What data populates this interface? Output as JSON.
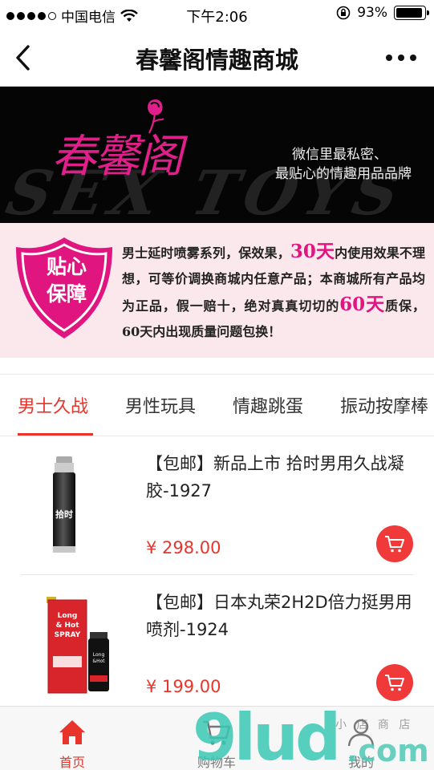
{
  "status_bar": {
    "carrier": "中国电信",
    "time": "下午2:06",
    "battery": "93%",
    "battery_level": 0.93,
    "signal_bars_filled": 4
  },
  "navbar": {
    "title": "春馨阁情趣商城"
  },
  "banner": {
    "logo_text": "春馨阁",
    "slogan_line1": "微信里最私密、",
    "slogan_line2": "最贴心的情趣用品品牌",
    "watermark": "SEX TOYS"
  },
  "guarantee": {
    "badge_line1": "贴心",
    "badge_line2": "保障",
    "text_part1": "男士延时喷雾系列，保效果，",
    "highlight1": "30天",
    "text_part2": "内使用效果不理想，可等价调换商城内任意产品；本商城所有产品均为正品，假一赔十，绝对真真切切的",
    "highlight2": "60天",
    "text_part3": "质保，60天内出现质量问题包换！"
  },
  "tabs": [
    {
      "label": "男士久战",
      "active": true
    },
    {
      "label": "男性玩具",
      "active": false
    },
    {
      "label": "情趣跳蛋",
      "active": false
    },
    {
      "label": "振动按摩棒",
      "active": false
    }
  ],
  "products": [
    {
      "title": "【包邮】新品上市 拾时男用久战凝胶-1927",
      "price": "¥ 298.00",
      "image_label": "拾时"
    },
    {
      "title": "【包邮】日本丸荣2H2D倍力挺男用喷剂-1924",
      "price": "¥ 199.00",
      "image_label": "Long & Hot SPRAY"
    }
  ],
  "bottom_nav": [
    {
      "label": "首页",
      "icon": "home-icon",
      "active": true
    },
    {
      "label": "购物车",
      "icon": "cart-icon",
      "active": false
    },
    {
      "label": "我的",
      "icon": "user-icon",
      "active": false
    }
  ],
  "watermark": {
    "big": "9lud",
    "com": ".com",
    "small": "小 店 商 店"
  },
  "colors": {
    "accent": "#e8342a",
    "brand_pink": "#e01f8a",
    "guarantee_bg": "#fbe8ec"
  }
}
